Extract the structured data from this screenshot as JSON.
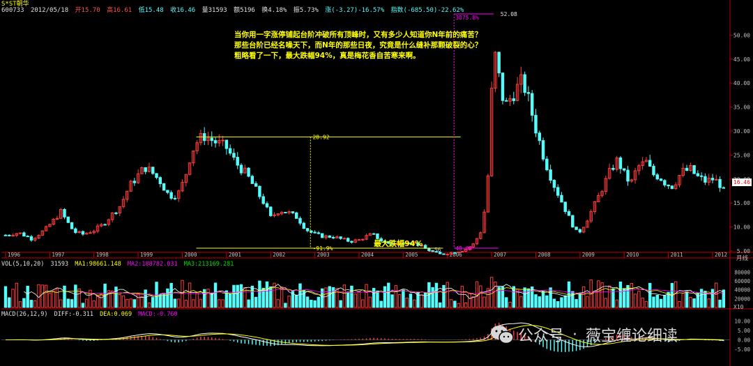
{
  "header": {
    "name": "S*ST朝华",
    "code": "600733",
    "date": "2012/05/18",
    "open": "开15.70",
    "high": "高16.61",
    "low": "低15.48",
    "close": "收16.46",
    "volume": "量31593",
    "amount": "额5196",
    "turnover": "换4.18%",
    "amplitude": "振5.73%",
    "change": "涨(-3.27)-16.57%",
    "index": "指数(-685.50)-22.62%"
  },
  "comment": [
    "当你用一字涨停铺起台阶冲破所有顶峰时，又有多少人知道你N年前的痛苦？",
    "那些台阶已经名噪天下，而N年的那些日夜，究竟是什么缝补那颗破裂的心？",
    "粗略看了一下，最大跌幅94%，真是梅花香自苦寒来啊。"
  ],
  "max_drop_label": "最大跌幅94%",
  "price_tag": "16.46",
  "year_unit_label": "月线",
  "vol_unit_label": "X10",
  "vol_header": {
    "label": "VOL(5,10,20)",
    "value": "31593",
    "ma1": "MA1:98661.148",
    "ma2": "MA2:188782.031",
    "ma3": "MA3:213169.281"
  },
  "macd_header": {
    "label": "MACD(26,12,9)",
    "diff": "DIFF:-0.311",
    "dea": "DEA:0.069",
    "macd": "MACD:-0.760"
  },
  "watermark": {
    "account": "公众号",
    "separator": "·",
    "name": "薇宝缠论细读"
  },
  "colors": {
    "up": "#ff3c3c",
    "down": "#54fcfc",
    "ma1": "#ffffff",
    "ma2": "#ffff00",
    "ma3": "#ff00ff",
    "ma4": "#00c000",
    "annotation": "#ffff00",
    "grid_red": "#800000",
    "axis": "#c00000"
  },
  "chart_data": {
    "type": "candlestick",
    "period": "monthly",
    "ylim": [
      5,
      55
    ],
    "y_ticks": [
      5,
      10,
      15,
      20,
      25,
      30,
      35,
      40,
      45,
      50
    ],
    "y_tick_labels": [
      "5.00",
      "10.00",
      "15.00",
      "20.00",
      "25.00",
      "30.00",
      "35.00",
      "40.00",
      "45.00",
      "50.00"
    ],
    "x_years": [
      "1996",
      "1997",
      "1998",
      "1999",
      "2000",
      "2001",
      "2002",
      "2003",
      "2004",
      "2005",
      "2006",
      "2007",
      "2008",
      "2009",
      "2010",
      "2011",
      "2012"
    ],
    "x_range": [
      1996.0,
      2012.3
    ],
    "annotations": {
      "peak_2000": {
        "value": 28.92,
        "label": "28.92",
        "x_from": 2000.0,
        "x_to": 2006.3
      },
      "bottom_2005": {
        "value": 1.56,
        "label": "1.56",
        "drop_label": "-91.9%"
      },
      "start_2006": {
        "value": 48.69,
        "label": "48.69"
      },
      "peak_2007": {
        "value": 52.08,
        "label": "52.08",
        "gain_label": "3075.8%"
      }
    },
    "anchors": [
      [
        1996.0,
        8.3
      ],
      [
        1996.3,
        8.8
      ],
      [
        1996.6,
        7.5
      ],
      [
        1996.9,
        9.5
      ],
      [
        1997.1,
        11.5
      ],
      [
        1997.25,
        13.2
      ],
      [
        1997.4,
        11.0
      ],
      [
        1997.55,
        9.0
      ],
      [
        1997.75,
        8.5
      ],
      [
        1998.0,
        9.3
      ],
      [
        1998.2,
        10.5
      ],
      [
        1998.4,
        12.5
      ],
      [
        1998.6,
        14.5
      ],
      [
        1998.8,
        18.5
      ],
      [
        1999.0,
        20.8
      ],
      [
        1999.15,
        22.5
      ],
      [
        1999.3,
        21.5
      ],
      [
        1999.5,
        19.5
      ],
      [
        1999.7,
        16.5
      ],
      [
        1999.9,
        16.8
      ],
      [
        2000.05,
        20.0
      ],
      [
        2000.2,
        25.5
      ],
      [
        2000.35,
        28.0
      ],
      [
        2000.5,
        29.0
      ],
      [
        2000.65,
        28.2
      ],
      [
        2000.8,
        27.5
      ],
      [
        2001.0,
        26.5
      ],
      [
        2001.2,
        23.5
      ],
      [
        2001.45,
        21.0
      ],
      [
        2001.65,
        18.0
      ],
      [
        2001.85,
        15.0
      ],
      [
        2002.0,
        12.0
      ],
      [
        2002.2,
        13.5
      ],
      [
        2002.4,
        13.0
      ],
      [
        2002.6,
        12.0
      ],
      [
        2002.8,
        9.5
      ],
      [
        2003.0,
        8.5
      ],
      [
        2003.2,
        8.0
      ],
      [
        2003.4,
        8.0
      ],
      [
        2003.6,
        7.5
      ],
      [
        2003.8,
        7.0
      ],
      [
        2004.0,
        7.3
      ],
      [
        2004.15,
        8.0
      ],
      [
        2004.3,
        8.5
      ],
      [
        2004.5,
        7.2
      ],
      [
        2004.7,
        6.5
      ],
      [
        2004.9,
        6.5
      ],
      [
        2005.1,
        7.0
      ],
      [
        2005.3,
        6.5
      ],
      [
        2005.5,
        5.5
      ],
      [
        2005.7,
        4.7
      ],
      [
        2005.85,
        4.3
      ],
      [
        2006.0,
        4.5
      ],
      [
        2006.15,
        4.8
      ],
      [
        2006.3,
        5.0
      ],
      [
        2006.45,
        5.5
      ],
      [
        2006.6,
        6.5
      ],
      [
        2006.75,
        9.0
      ],
      [
        2006.85,
        14.0
      ],
      [
        2006.95,
        24.0
      ],
      [
        2007.0,
        38.0
      ],
      [
        2007.1,
        47.0
      ],
      [
        2007.18,
        40.0
      ],
      [
        2007.3,
        35.0
      ],
      [
        2007.5,
        38.0
      ],
      [
        2007.7,
        40.5
      ],
      [
        2007.85,
        36.0
      ],
      [
        2008.0,
        30.5
      ],
      [
        2008.2,
        24.0
      ],
      [
        2008.4,
        19.0
      ],
      [
        2008.6,
        15.0
      ],
      [
        2008.8,
        11.0
      ],
      [
        2008.95,
        8.5
      ],
      [
        2009.1,
        10.5
      ],
      [
        2009.3,
        14.0
      ],
      [
        2009.5,
        18.0
      ],
      [
        2009.7,
        22.0
      ],
      [
        2009.85,
        24.0
      ],
      [
        2010.0,
        21.0
      ],
      [
        2010.15,
        19.0
      ],
      [
        2010.3,
        22.5
      ],
      [
        2010.5,
        23.5
      ],
      [
        2010.65,
        21.0
      ],
      [
        2010.8,
        20.5
      ],
      [
        2010.95,
        19.0
      ],
      [
        2011.1,
        18.5
      ],
      [
        2011.3,
        21.5
      ],
      [
        2011.5,
        22.0
      ],
      [
        2011.65,
        20.5
      ],
      [
        2011.85,
        19.5
      ],
      [
        2012.0,
        20.0
      ],
      [
        2012.15,
        19.2
      ],
      [
        2012.3,
        16.46
      ]
    ],
    "macd_range": [
      -12,
      12
    ],
    "vol_range": [
      0,
      90000
    ]
  }
}
